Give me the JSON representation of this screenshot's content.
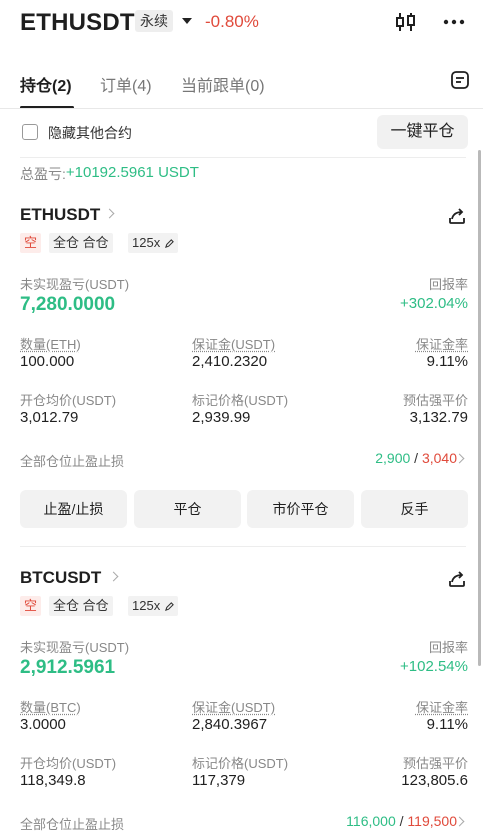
{
  "header": {
    "symbol": "ETHUSDT",
    "contract_type": "永续",
    "change": "-0.80%",
    "icons": [
      "candlestick-icon",
      "more-icon"
    ]
  },
  "tabs": [
    {
      "label": "持仓(2)",
      "active": true
    },
    {
      "label": "订单(4)",
      "active": false
    },
    {
      "label": "当前跟单(0)",
      "active": false
    }
  ],
  "hide_other": {
    "label": "隐藏其他合约",
    "checked": false
  },
  "close_all_label": "一键平仓",
  "total_pnl": {
    "label": "总盈亏:",
    "value": "+10192.5961 USDT"
  },
  "labels": {
    "unrealized": "未实现盈亏(USDT)",
    "roi": "回报率",
    "margin": "保证金(USDT)",
    "margin_rate": "保证金率",
    "entry_price": "开仓均价(USDT)",
    "mark_price": "标记价格(USDT)",
    "liq_price": "预估强平价",
    "tpsl": "全部仓位止盈止损"
  },
  "actions": [
    "止盈/止损",
    "平仓",
    "市价平仓",
    "反手"
  ],
  "positions": [
    {
      "symbol": "ETHUSDT",
      "side": "空",
      "margin_mode": "全仓 合仓",
      "leverage": "125x",
      "unrealized_pnl": "7,280.0000",
      "roi": "+302.04%",
      "qty_label": "数量(ETH)",
      "qty": "100.000",
      "margin": "2,410.2320",
      "margin_rate": "9.11%",
      "entry_price": "3,012.79",
      "mark_price": "2,939.99",
      "liq_price": "3,132.79",
      "tp": "2,900",
      "sl": "3,040"
    },
    {
      "symbol": "BTCUSDT",
      "side": "空",
      "margin_mode": "全仓 合仓",
      "leverage": "125x",
      "unrealized_pnl": "2,912.5961",
      "roi": "+102.54%",
      "qty_label": "数量(BTC)",
      "qty": "3.0000",
      "margin": "2,840.3967",
      "margin_rate": "9.11%",
      "entry_price": "118,349.8",
      "mark_price": "117,379",
      "liq_price": "123,805.6",
      "tp": "116,000",
      "sl": "119,500"
    }
  ],
  "colors": {
    "profit": "#2ebd85",
    "loss": "#e04a3b",
    "button_bg": "#f2f2f2"
  }
}
